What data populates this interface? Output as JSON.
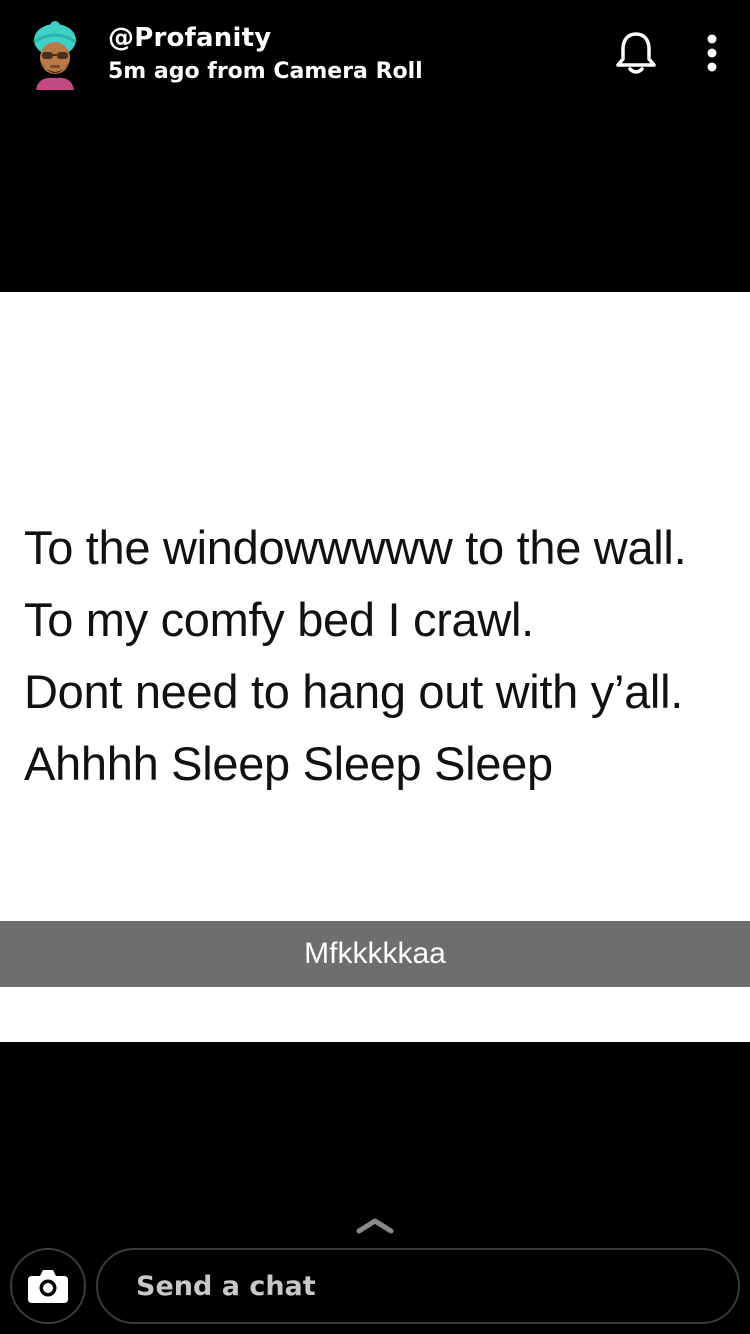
{
  "header": {
    "username": "@Profanity",
    "subtitle": "5m ago from Camera Roll",
    "avatar_icon": "bitmoji-avatar-icon",
    "bell_icon": "bell-icon",
    "more_icon": "more-vertical-icon"
  },
  "snap": {
    "lines": [
      "To the windowwwww to the wall.",
      "To my comfy bed I crawl.",
      "Dont need to hang out with y’all.",
      "Ahhhh Sleep Sleep Sleep"
    ],
    "caption": "Mfkkkkkaa"
  },
  "footer": {
    "swipe_icon": "chevron-up-icon",
    "camera_icon": "camera-icon",
    "chat_placeholder": "Send a chat"
  },
  "colors": {
    "background": "#000000",
    "caption_bar": "#6e6e6e",
    "avatar_hat": "#3fd1c7",
    "skin": "#b97a45"
  }
}
